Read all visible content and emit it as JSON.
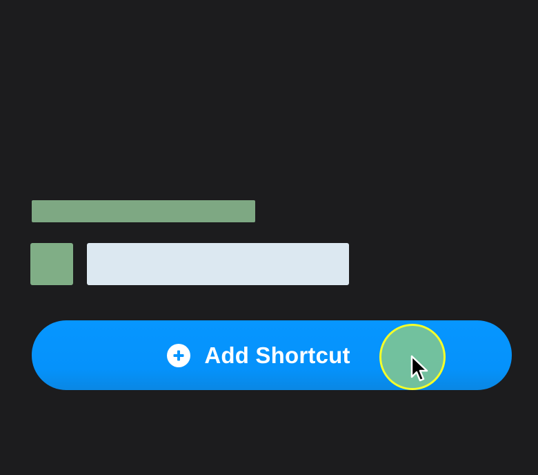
{
  "add_shortcut": {
    "label": "Add Shortcut",
    "icon": "plus-circle-icon",
    "color": "#0796ff"
  },
  "placeholders": {
    "title_color": "#7ea883",
    "icon_color": "#80ae86",
    "text_color": "#dce8f1"
  },
  "cursor": {
    "icon": "arrow-pointer-icon",
    "highlight_ring_color": "#f5ff2a",
    "highlight_fill_color": "#7cc496"
  }
}
